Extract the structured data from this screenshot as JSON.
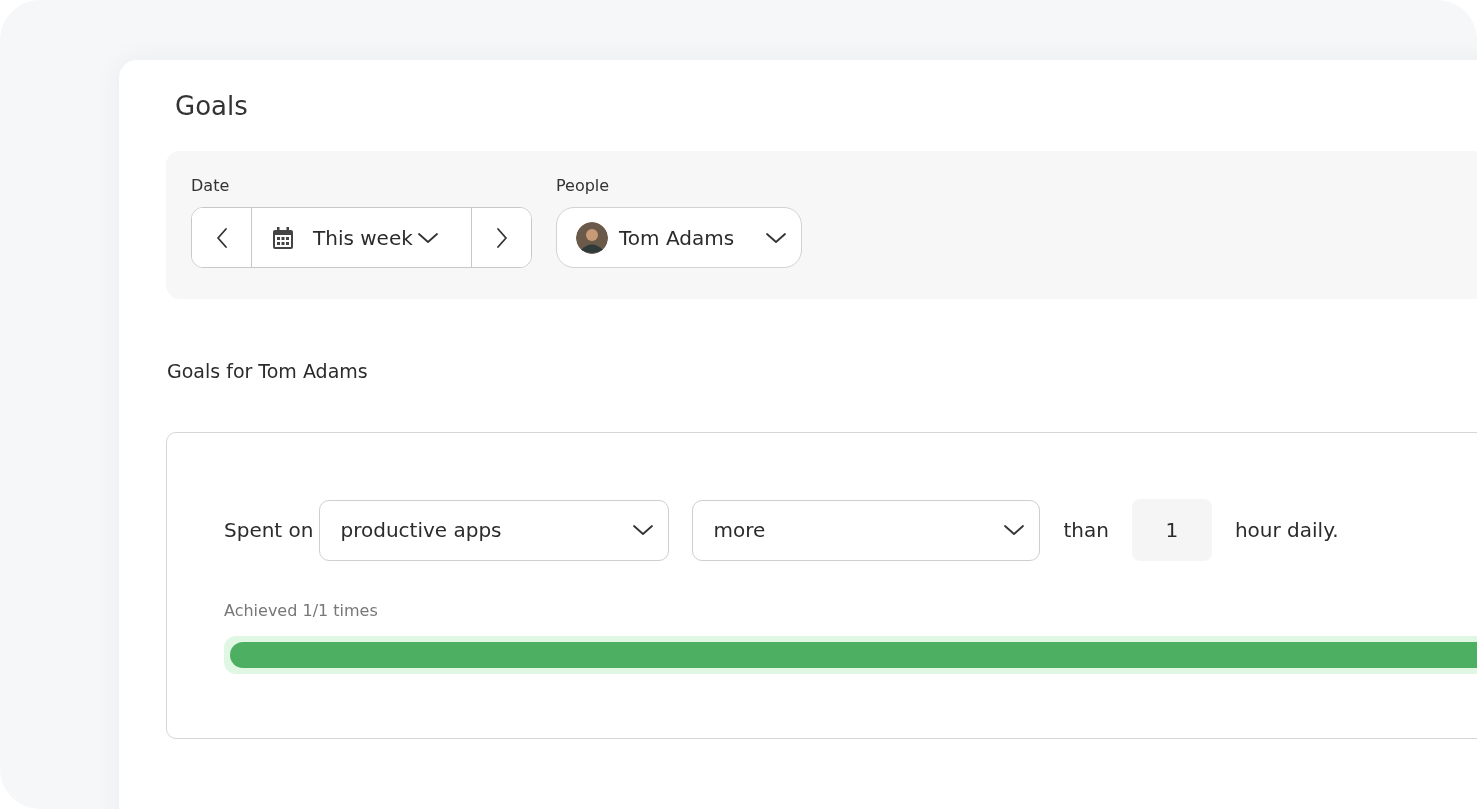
{
  "title": "Goals",
  "filters": {
    "date": {
      "label": "Date",
      "value": "This week"
    },
    "people": {
      "label": "People",
      "value": "Tom Adams"
    }
  },
  "goals_heading": "Goals for Tom Adams",
  "goal": {
    "prefix": "Spent on",
    "category": "productive apps",
    "comparison": "more",
    "connector": "than",
    "amount": "1",
    "suffix": "hour daily.",
    "progress_text": "Achieved 1/1 times",
    "level": 1
  }
}
